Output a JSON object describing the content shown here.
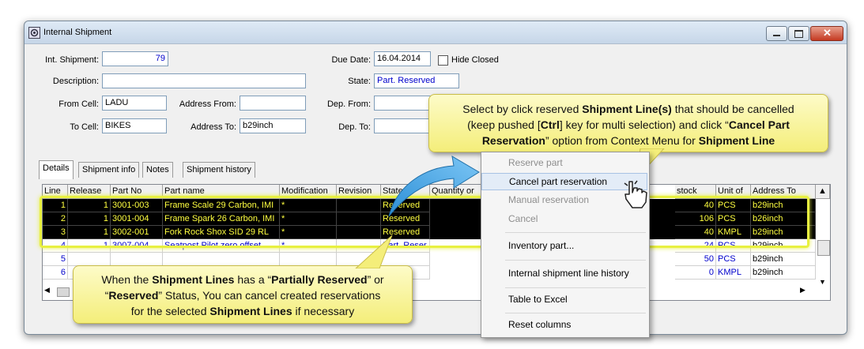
{
  "window": {
    "title": "Internal Shipment"
  },
  "form": {
    "int_shipment_label": "Int. Shipment:",
    "int_shipment_value": "79",
    "due_date_label": "Due Date:",
    "due_date_value": "16.04.2014",
    "hide_closed_label": "Hide Closed",
    "description_label": "Description:",
    "description_value": "",
    "state_label": "State:",
    "state_value": "Part. Reserved",
    "from_cell_label": "From Cell:",
    "from_cell_value": "LADU",
    "address_from_label": "Address From:",
    "address_from_value": "",
    "dep_from_label": "Dep. From:",
    "dep_from_value": "",
    "to_cell_label": "To Cell:",
    "to_cell_value": "BIKES",
    "address_to_label": "Address To:",
    "address_to_value": "b29inch",
    "dep_to_label": "Dep. To:",
    "dep_to_value": ""
  },
  "tabs": [
    "Details",
    "Shipment info",
    "Notes",
    "Shipment history"
  ],
  "grid": {
    "headers_left": [
      "Line",
      "Release",
      "Part No",
      "Part name",
      "Modification",
      "Revision",
      "State",
      "Quantity or"
    ],
    "headers_right": [
      "stock",
      "Unit of",
      "Address To"
    ],
    "rows": [
      {
        "line": "1",
        "release": "1",
        "part_no": "3001-003",
        "part_name": "Frame Scale 29 Carbon, IMI",
        "modification": "*",
        "revision": "",
        "state": "Reserved",
        "stock": "40",
        "unit": "PCS",
        "address": "b29inch"
      },
      {
        "line": "2",
        "release": "1",
        "part_no": "3001-004",
        "part_name": "Frame Spark 26 Carbon, IMI",
        "modification": "*",
        "revision": "",
        "state": "Reserved",
        "stock": "106",
        "unit": "PCS",
        "address": "b26inch"
      },
      {
        "line": "3",
        "release": "1",
        "part_no": "3002-001",
        "part_name": "Fork Rock Shox SID 29 RL",
        "modification": "*",
        "revision": "",
        "state": "Reserved",
        "stock": "40",
        "unit": "KMPL",
        "address": "b29inch"
      },
      {
        "line": "4",
        "release": "1",
        "part_no": "3007-004",
        "part_name": "Seatpost Pilot zero offset",
        "modification": "*",
        "revision": "",
        "state": "Part. Reser",
        "stock": "24",
        "unit": "PCS",
        "address": "b29inch"
      },
      {
        "line": "5",
        "release": "",
        "part_no": "",
        "part_name": "",
        "modification": "",
        "revision": "",
        "state": "",
        "stock": "50",
        "unit": "PCS",
        "address": "b29inch"
      },
      {
        "line": "6",
        "release": "",
        "part_no": "",
        "part_name": "",
        "modification": "",
        "revision": "",
        "state": "",
        "stock": "0",
        "unit": "KMPL",
        "address": "b29inch"
      }
    ]
  },
  "context_menu": {
    "items": [
      {
        "label": "Reserve part",
        "state": "disabled"
      },
      {
        "label": "Cancel part reservation",
        "state": "hover"
      },
      {
        "label": "Manual reservation",
        "state": "disabled"
      },
      {
        "label": "Cancel",
        "state": "disabled"
      },
      {
        "label": "Inventory part...",
        "state": "enabled"
      },
      {
        "label": "Internal shipment line history",
        "state": "enabled"
      },
      {
        "label": "Table to Excel",
        "state": "enabled"
      },
      {
        "label": "Reset columns",
        "state": "enabled"
      }
    ]
  },
  "callout_top": {
    "line1_a": "Select by click reserved ",
    "line1_b": "Shipment Line(s)",
    "line1_c": " that should be cancelled",
    "line2_a": "(keep pushed [",
    "line2_b": "Ctrl",
    "line2_c": "] key for multi selection) and click “",
    "line2_d": "Cancel Part",
    "line3_a": "Reservation",
    "line3_b": "” option from Context Menu for ",
    "line3_c": "Shipment Line"
  },
  "callout_bottom": {
    "line1_a": "When the ",
    "line1_b": "Shipment Lines",
    "line1_c": " has a “",
    "line1_d": "Partially Reserved",
    "line1_e": "” or",
    "line2_a": "“",
    "line2_b": "Reserved",
    "line2_c": "” Status, You can cancel created reservations",
    "line3_a": "for the selected ",
    "line3_b": "Shipment Lines",
    "line3_c": " if necessary"
  },
  "colors": {
    "selected_row_bg": "#000000",
    "selected_row_text": "#ffff40",
    "link_text": "#0000cc",
    "callout_bg": "#f8f3a0"
  }
}
